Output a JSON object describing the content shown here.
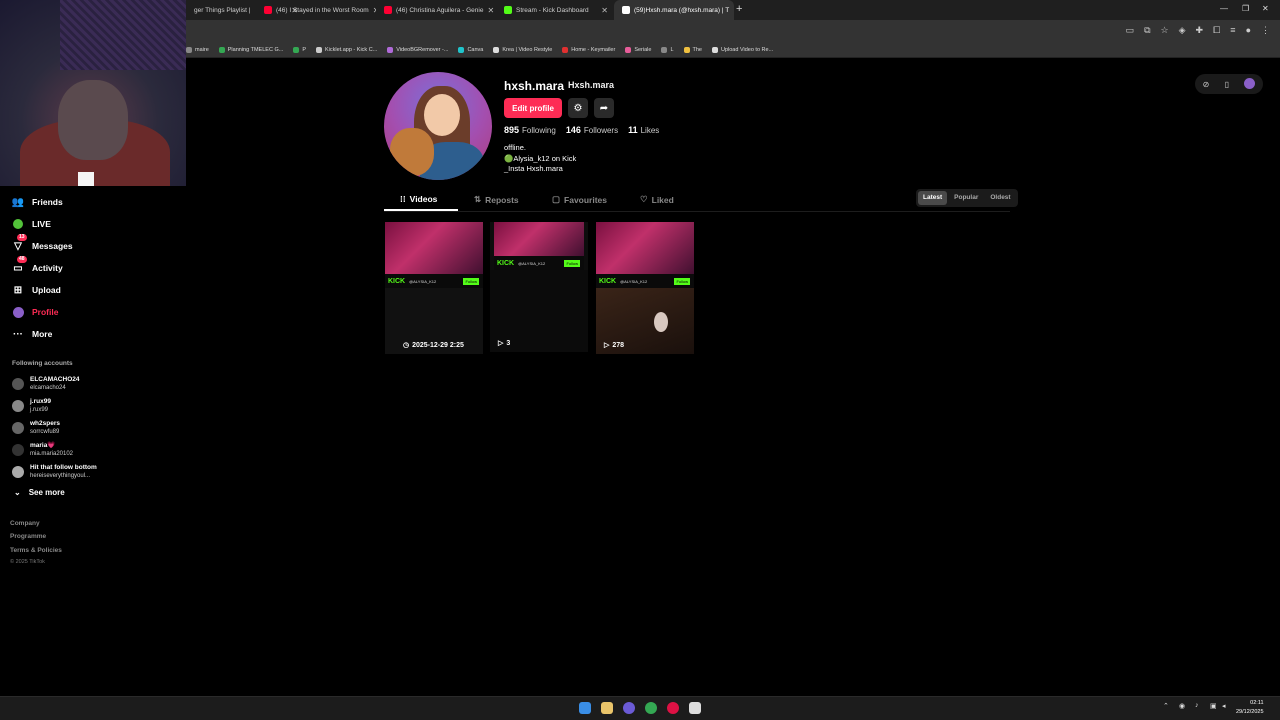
{
  "browser": {
    "tabs": [
      {
        "title": "ger Things Playlist |",
        "color": "#888888"
      },
      {
        "title": "(46) I Stayed in the Worst Room",
        "color": "#ff0033"
      },
      {
        "title": "(46) Christina Aguilera - Genie",
        "color": "#ff0033"
      },
      {
        "title": "Stream - Kick Dashboard",
        "color": "#53fc18"
      },
      {
        "title": "(59)Hxsh.mara (@hxsh.mara) | T",
        "color": "#ffffff"
      }
    ],
    "bookmarks": [
      {
        "label": "maire",
        "color": "#888888"
      },
      {
        "label": "Planning TMELEC G...",
        "color": "#34a853"
      },
      {
        "label": "P",
        "color": "#34a853"
      },
      {
        "label": "Kicklet.app - Kick C...",
        "color": "#cccccc"
      },
      {
        "label": "VideoBGRemover -...",
        "color": "#b06ad9"
      },
      {
        "label": "Canva",
        "color": "#20c4cb"
      },
      {
        "label": "Krea | Video Restyle",
        "color": "#dddddd"
      },
      {
        "label": "Home - Keymailer",
        "color": "#e03030"
      },
      {
        "label": "Seriale",
        "color": "#e85d9a"
      },
      {
        "label": "L",
        "color": "#888888"
      },
      {
        "label": "The",
        "color": "#f0c040"
      },
      {
        "label": "Upload Video to Re...",
        "color": "#dddddd"
      }
    ]
  },
  "nav": {
    "items": [
      {
        "label": "Friends",
        "icon": "friends-icon"
      },
      {
        "label": "LIVE",
        "icon": "live-icon"
      },
      {
        "label": "Messages",
        "icon": "messages-icon",
        "badge": "13"
      },
      {
        "label": "Activity",
        "icon": "activity-icon",
        "badge": "48"
      },
      {
        "label": "Upload",
        "icon": "upload-icon"
      },
      {
        "label": "Profile",
        "icon": "avatar"
      },
      {
        "label": "More",
        "icon": "more-icon"
      }
    ],
    "following_title": "Following accounts",
    "following": [
      {
        "name": "ELCAMACHO24",
        "handle": "elcamacho24"
      },
      {
        "name": "j.rux99",
        "handle": "j.rux99"
      },
      {
        "name": "wh2spers",
        "handle": "sorrcwfu89"
      },
      {
        "name": "maria💗",
        "handle": "mia.maria20102"
      },
      {
        "name": "Hit that follow bottom",
        "handle": "hereiseverythingyoul..."
      }
    ],
    "see_more": "See more",
    "footer": [
      "Company",
      "Programme",
      "Terms & Policies"
    ],
    "copyright": "© 2025 TikTok"
  },
  "profile": {
    "username": "hxsh.mara",
    "nickname": "Hxsh.mara",
    "edit_label": "Edit profile",
    "following_count": "895",
    "following_label": "Following",
    "followers_count": "146",
    "followers_label": "Followers",
    "likes_count": "11",
    "likes_label": "Likes",
    "bio": [
      "offline.",
      "🟢Alysia_k12 on Kick",
      "_Insta Hxsh.mara"
    ]
  },
  "tabs": [
    {
      "label": "Videos",
      "icon": "grid-icon"
    },
    {
      "label": "Reposts",
      "icon": "repost-icon"
    },
    {
      "label": "Favourites",
      "icon": "bookmark-icon"
    },
    {
      "label": "Liked",
      "icon": "heart-icon"
    }
  ],
  "sort": [
    "Latest",
    "Popular",
    "Oldest"
  ],
  "videos": [
    {
      "meta": "2025-12-29 2:25",
      "meta_icon": "clock-icon",
      "kick_user": "@ALYSIA_K12",
      "follow": "Follow"
    },
    {
      "meta": "3",
      "meta_icon": "play-icon",
      "kick_user": "@ALYSIA_K12",
      "follow": "Follow"
    },
    {
      "meta": "278",
      "meta_icon": "play-icon",
      "kick_user": "@ALYSIA_K12",
      "follow": "Follow"
    }
  ],
  "kick_label": "KICK",
  "taskbar": {
    "time": "02:11",
    "date": "29/12/2025"
  }
}
